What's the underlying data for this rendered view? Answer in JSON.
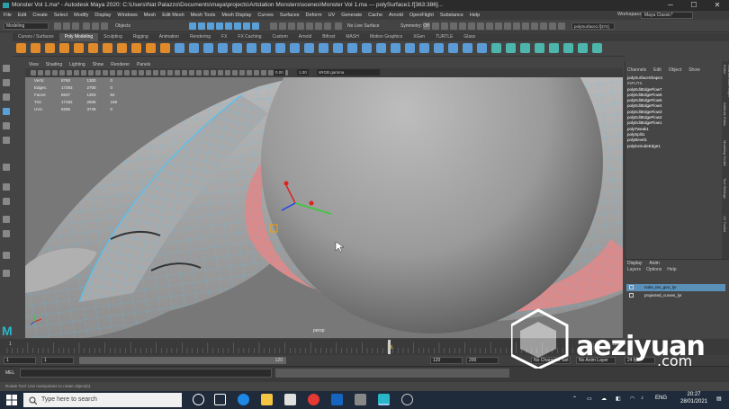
{
  "window": {
    "title": "Monster Vol 1.ma* - Autodesk Maya 2020: C:\\Users\\Nat Palazzo\\Documents\\maya\\projects\\Artstation Monsters\\scenes\\Monster Vol 1.ma  ---  polySurface1.f[363:386]...",
    "minimize": "─",
    "maximize": "☐",
    "close": "✕"
  },
  "menubar": [
    "File",
    "Edit",
    "Create",
    "Select",
    "Modify",
    "Display",
    "Windows",
    "Mesh",
    "Edit Mesh",
    "Mesh Tools",
    "Mesh Display",
    "Curves",
    "Surfaces",
    "Deform",
    "UV",
    "Generate",
    "Cache",
    "Arnold",
    "OpenFlight",
    "Substance",
    "Help"
  ],
  "workspace": {
    "label": "Workspace :",
    "value": "Maya Classic*"
  },
  "statusline": {
    "mode": "Modeling",
    "objects": "Objects",
    "live_surface": "No Live Surface",
    "symmetry": "Symmetry: Off",
    "selection_field": "polySurface1.f[374]"
  },
  "shelf_tabs": [
    "Curves / Surfaces",
    "Poly Modeling",
    "Sculpting",
    "Rigging",
    "Animation",
    "Rendering",
    "FX",
    "FX Caching",
    "Custom",
    "Arnold",
    "Bifrost",
    "MASH",
    "Motion Graphics",
    "XGen",
    "TURTLE",
    "Glass"
  ],
  "shelf_active": "Poly Modeling",
  "panel_menu": [
    "View",
    "Shading",
    "Lighting",
    "Show",
    "Renderer",
    "Panels"
  ],
  "panel_toolbar": {
    "value_a": "0.00",
    "value_b": "1.00",
    "colorspace": "sRGB gamma"
  },
  "hud": {
    "rows": [
      {
        "label": "Verts:",
        "v1": "8760",
        "v2": "1300",
        "v3": "0"
      },
      {
        "label": "Edges:",
        "v1": "17393",
        "v2": "2700",
        "v3": "0"
      },
      {
        "label": "Faces:",
        "v1": "8637",
        "v2": "1303",
        "v3": "84"
      },
      {
        "label": "Tris:",
        "v1": "17182",
        "v2": "2606",
        "v3": "168"
      },
      {
        "label": "UVs:",
        "v1": "8295",
        "v2": "3749",
        "v3": "0"
      }
    ]
  },
  "camera_label": "persp",
  "channel_box": {
    "menu": [
      "Channels",
      "Edit",
      "Object",
      "Show"
    ],
    "items": [
      "polySurfaceShape1",
      "INPUTS",
      "polyEditEdgeFlow7",
      "polyEditEdgeFlow6",
      "polyEditEdgeFlow5",
      "polyEditEdgeFlow4",
      "polyEditEdgeFlow3",
      "polyEditEdgeFlow2",
      "polyEditEdgeFlow1",
      "polyTweak1",
      "polySplit1",
      "polyBevel1",
      "polyExtrudeEdge1"
    ]
  },
  "side_tabs": [
    "Channel Box / Layer Editor",
    "Attribute Editor",
    "Modeling Toolkit",
    "Tool Settings",
    "UV Toolkit"
  ],
  "layers": {
    "tabs": [
      "Display",
      "Anim"
    ],
    "menu": [
      "Layers",
      "Options",
      "Help"
    ],
    "rows": [
      {
        "name": "nuke_tex_geo_lyr",
        "selected": true
      },
      {
        "name": "projected_curves_lyr",
        "selected": false
      }
    ]
  },
  "timeline": {
    "ticks": [
      "1",
      "",
      "",
      "",
      "",
      "",
      "",
      "",
      "",
      "",
      "",
      "",
      "",
      "",
      "",
      "",
      "",
      "",
      "",
      "",
      "",
      "",
      "",
      "",
      "",
      "",
      "",
      "",
      "",
      "",
      "",
      "",
      "",
      "",
      "",
      "",
      "",
      "",
      "",
      "",
      "",
      "",
      "",
      "",
      "",
      "",
      "",
      "",
      "",
      "",
      "",
      "",
      "",
      "",
      "",
      "",
      "",
      "",
      "",
      "",
      "",
      "",
      "",
      "",
      "",
      "",
      "",
      "",
      "",
      "",
      "",
      "",
      "",
      "",
      "",
      "",
      "",
      "",
      "",
      "",
      "",
      "",
      "",
      "",
      "",
      "",
      "",
      "",
      "",
      "",
      "",
      "",
      "",
      "",
      "",
      "",
      "",
      "",
      "",
      "",
      "",
      "",
      "",
      "",
      "",
      "120"
    ],
    "current_frame": "76"
  },
  "range": {
    "start": "1",
    "start_inner": "1",
    "end_inner": "120",
    "end": "120",
    "end_outer": "200",
    "char_set": "No Character Set",
    "anim_layer": "No Anim Layer",
    "fps": "24 fps"
  },
  "cmdline": {
    "label": "MEL"
  },
  "helpline": {
    "text": "Rotate Tool: Use manipulator to rotate object(s)."
  },
  "taskbar": {
    "search_placeholder": "Type here to search",
    "lang": "ENG",
    "time": "20:27",
    "date": "28/01/2021"
  },
  "watermark": {
    "text": "aeziyuan",
    "suffix": ".com"
  }
}
